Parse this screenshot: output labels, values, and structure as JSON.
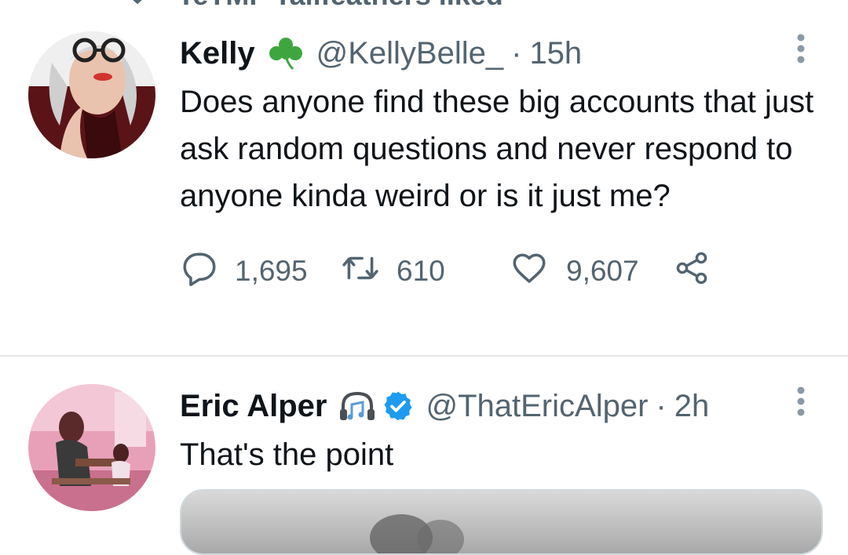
{
  "social_context": {
    "text": "TeTMF Tallfeathers liked",
    "icon": "heart-icon"
  },
  "tweets": [
    {
      "display_name": "Kelly",
      "emoji_icon": "shamrock-icon",
      "handle": "@KellyBelle_",
      "dot": "·",
      "time": "15h",
      "text": "Does anyone find these big accounts that just ask random questions and never respond to anyone kinda weird or is it just me?",
      "replies": "1,695",
      "retweets": "610",
      "likes": "9,607"
    },
    {
      "display_name": "Eric Alper",
      "emoji_icon": "headphones-music-icon",
      "verified": true,
      "handle": "@ThatEricAlper",
      "dot": "·",
      "time": "2h",
      "text": "That's the point",
      "has_media": true
    }
  ],
  "colors": {
    "text_primary": "#0f1419",
    "text_secondary": "#536471",
    "verified_blue": "#1d9bf0",
    "shamrock_green": "#3fa63f",
    "divider": "#e4e8ea"
  }
}
